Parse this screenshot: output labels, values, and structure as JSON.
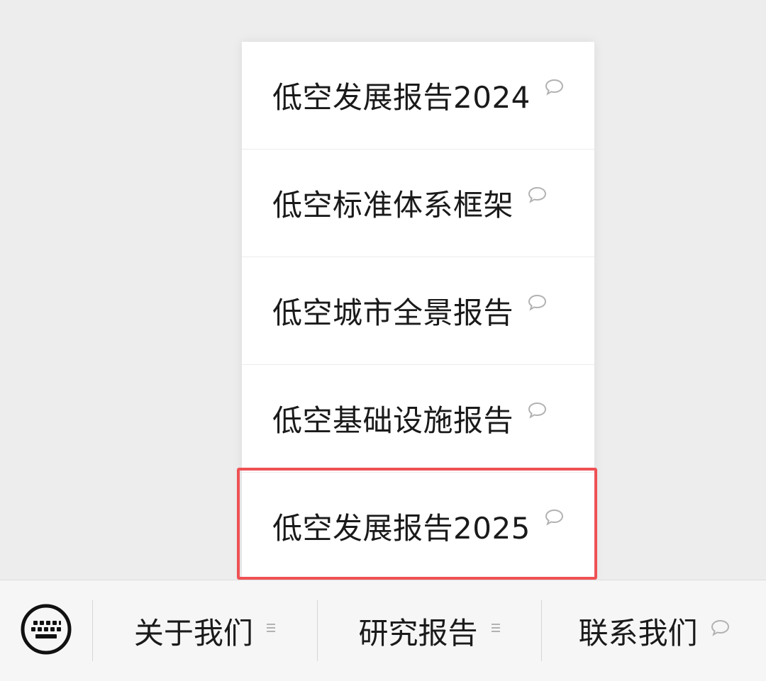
{
  "submenu": {
    "items": [
      {
        "label": "低空发展报告2024",
        "icon": "chat-bubble-icon"
      },
      {
        "label": "低空标准体系框架",
        "icon": "chat-bubble-icon"
      },
      {
        "label": "低空城市全景报告",
        "icon": "chat-bubble-icon"
      },
      {
        "label": "低空基础设施报告",
        "icon": "chat-bubble-icon"
      },
      {
        "label": "低空发展报告2025",
        "icon": "chat-bubble-icon",
        "highlighted": true
      }
    ]
  },
  "menubar": {
    "keyboard_icon": "keyboard-icon",
    "tabs": [
      {
        "label": "关于我们",
        "icon": "submenu-lines-icon"
      },
      {
        "label": "研究报告",
        "icon": "submenu-lines-icon"
      },
      {
        "label": "联系我们",
        "icon": "chat-bubble-icon"
      }
    ]
  },
  "colors": {
    "background": "#ededed",
    "highlight_border": "#ef5155",
    "text": "#1a1a1a",
    "icon": "#b2b2b2"
  }
}
